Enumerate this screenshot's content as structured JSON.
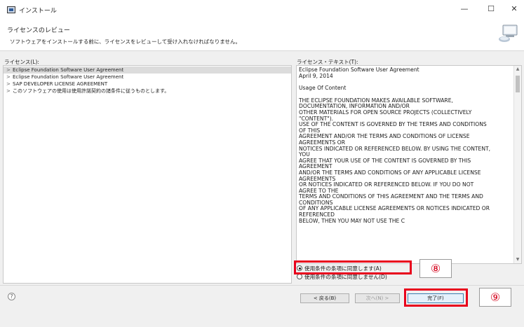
{
  "window": {
    "title": "インストール",
    "minimize": "—",
    "maximize": "☐",
    "close": "✕"
  },
  "header": {
    "page_title": "ライセンスのレビュー",
    "description": "ソフトウェアをインストールする前に、ライセンスをレビューして受け入れなければなりません。"
  },
  "licenses": {
    "label": "ライセンス(L):",
    "items": [
      {
        "label": "Eclipse Foundation Software User Agreement",
        "selected": true
      },
      {
        "label": "Eclipse Foundation Software User Agreement",
        "selected": false
      },
      {
        "label": "SAP DEVELOPER LICENSE AGREEMENT",
        "selected": false
      },
      {
        "label": "このソフトウェアの使用は使用許諾契約の諸条件に従うものとします。",
        "selected": false
      }
    ]
  },
  "license_text": {
    "label": "ライセンス・テキスト(T):",
    "lines": [
      "Eclipse Foundation Software User Agreement",
      "April 9, 2014",
      "",
      "Usage Of Content",
      "",
      "THE ECLIPSE FOUNDATION MAKES AVAILABLE SOFTWARE,",
      "DOCUMENTATION, INFORMATION AND/OR",
      "OTHER MATERIALS FOR OPEN SOURCE PROJECTS (COLLECTIVELY",
      "\"CONTENT\").",
      "USE OF THE CONTENT IS GOVERNED BY THE TERMS AND CONDITIONS",
      "OF THIS",
      "AGREEMENT AND/OR THE TERMS AND CONDITIONS OF LICENSE",
      "AGREEMENTS OR",
      "NOTICES INDICATED OR REFERENCED BELOW.  BY USING THE CONTENT,",
      "YOU",
      "AGREE THAT YOUR USE OF THE CONTENT IS GOVERNED BY THIS",
      "AGREEMENT",
      "AND/OR THE TERMS AND CONDITIONS OF ANY APPLICABLE LICENSE",
      "AGREEMENTS",
      "OR NOTICES INDICATED OR REFERENCED BELOW.  IF YOU DO NOT",
      "AGREE TO THE",
      "TERMS AND CONDITIONS OF THIS AGREEMENT AND THE TERMS AND",
      "CONDITIONS",
      "OF ANY APPLICABLE LICENSE AGREEMENTS OR NOTICES INDICATED OR",
      "REFERENCED",
      "BELOW, THEN YOU MAY NOT USE THE C"
    ]
  },
  "options": {
    "accept": "使用条件の条項に同意します(A)",
    "decline": "使用条件の条項に同意しません(D)"
  },
  "annotations": {
    "step8": "⑧",
    "step9": "⑨",
    "highlight_color": "#e8001c"
  },
  "footer": {
    "help_icon": "?",
    "back": "< 戻る(B)",
    "next": "次へ(N) >",
    "finish": "完了(F)"
  }
}
